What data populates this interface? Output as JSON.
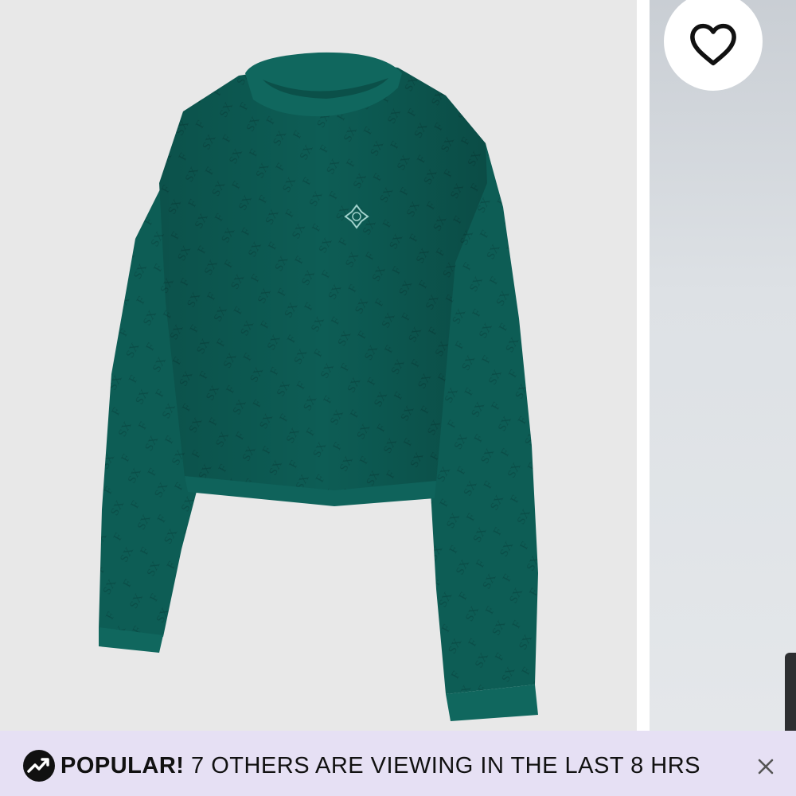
{
  "product": {
    "main_image": {
      "icon": "sweater-image",
      "background": "#e8e8e8",
      "garment_color": "#0c5a53",
      "pattern_text": "Savage X Fenty"
    },
    "secondary_image": {
      "background": "#d9dde1"
    },
    "wishlist": {
      "icon": "heart-icon"
    }
  },
  "banner": {
    "icon": "trending-up-icon",
    "label": "POPULAR!",
    "message": "7 OTHERS ARE VIEWING IN THE LAST 8 HRS",
    "close_icon": "close-icon",
    "background": "#e6e0f4"
  }
}
